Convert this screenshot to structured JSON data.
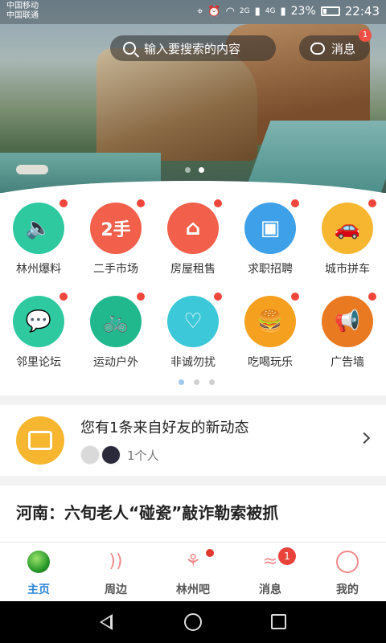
{
  "status_bar": {
    "carrier_1": "中国移动",
    "carrier_2": "中国联通",
    "network_1": "2G",
    "network_2": "4G",
    "battery": "23%",
    "battery_level": 0.23,
    "time": "22:43"
  },
  "banner": {
    "slide_count": 2,
    "active_slide": 1
  },
  "search": {
    "placeholder": "输入要搜索的内容"
  },
  "message_button": {
    "label": "消息",
    "badge": "1"
  },
  "grid": {
    "items": [
      {
        "label": "林州爆料",
        "icon": "megaphone-speaker-icon",
        "color": "#2fc9a0",
        "glyph": "🔈"
      },
      {
        "label": "二手市场",
        "icon": "second-hand-icon",
        "color": "#f2604c",
        "glyph": "2手"
      },
      {
        "label": "房屋租售",
        "icon": "house-icon",
        "color": "#f2604c",
        "glyph": "⌂"
      },
      {
        "label": "求职招聘",
        "icon": "briefcase-icon",
        "color": "#3ea0e8",
        "glyph": "▣"
      },
      {
        "label": "城市拼车",
        "icon": "car-icon",
        "color": "#f6b630",
        "glyph": "🚗"
      },
      {
        "label": "邻里论坛",
        "icon": "chat-bubbles-icon",
        "color": "#2fc9a0",
        "glyph": "💬"
      },
      {
        "label": "运动户外",
        "icon": "cycling-icon",
        "color": "#22b88e",
        "glyph": "🚲"
      },
      {
        "label": "非诚勿扰",
        "icon": "hearts-icon",
        "color": "#3cc8d8",
        "glyph": "♡"
      },
      {
        "label": "吃喝玩乐",
        "icon": "food-drink-icon",
        "color": "#f6a020",
        "glyph": "🍔"
      },
      {
        "label": "广告墙",
        "icon": "loudspeaker-icon",
        "color": "#ea7a22",
        "glyph": "📢"
      }
    ],
    "page_count": 3,
    "active_page": 0
  },
  "friend_update": {
    "title": "您有1条来自好友的新动态",
    "count_text": "1个人"
  },
  "news": {
    "headline": "河南：六旬老人“碰瓷”敲诈勒索被抓"
  },
  "tabbar": {
    "tabs": [
      {
        "label": "主页",
        "icon": "globe-icon",
        "active": true
      },
      {
        "label": "周边",
        "icon": "nearby-icon",
        "active": false
      },
      {
        "label": "林州吧",
        "icon": "plant-icon",
        "active": false
      },
      {
        "label": "消息",
        "icon": "message-icon",
        "active": false,
        "badge": "1"
      },
      {
        "label": "我的",
        "icon": "profile-icon",
        "active": false
      }
    ]
  },
  "colors": {
    "accent_blue": "#2a83d8",
    "badge_red": "#f0463c"
  }
}
